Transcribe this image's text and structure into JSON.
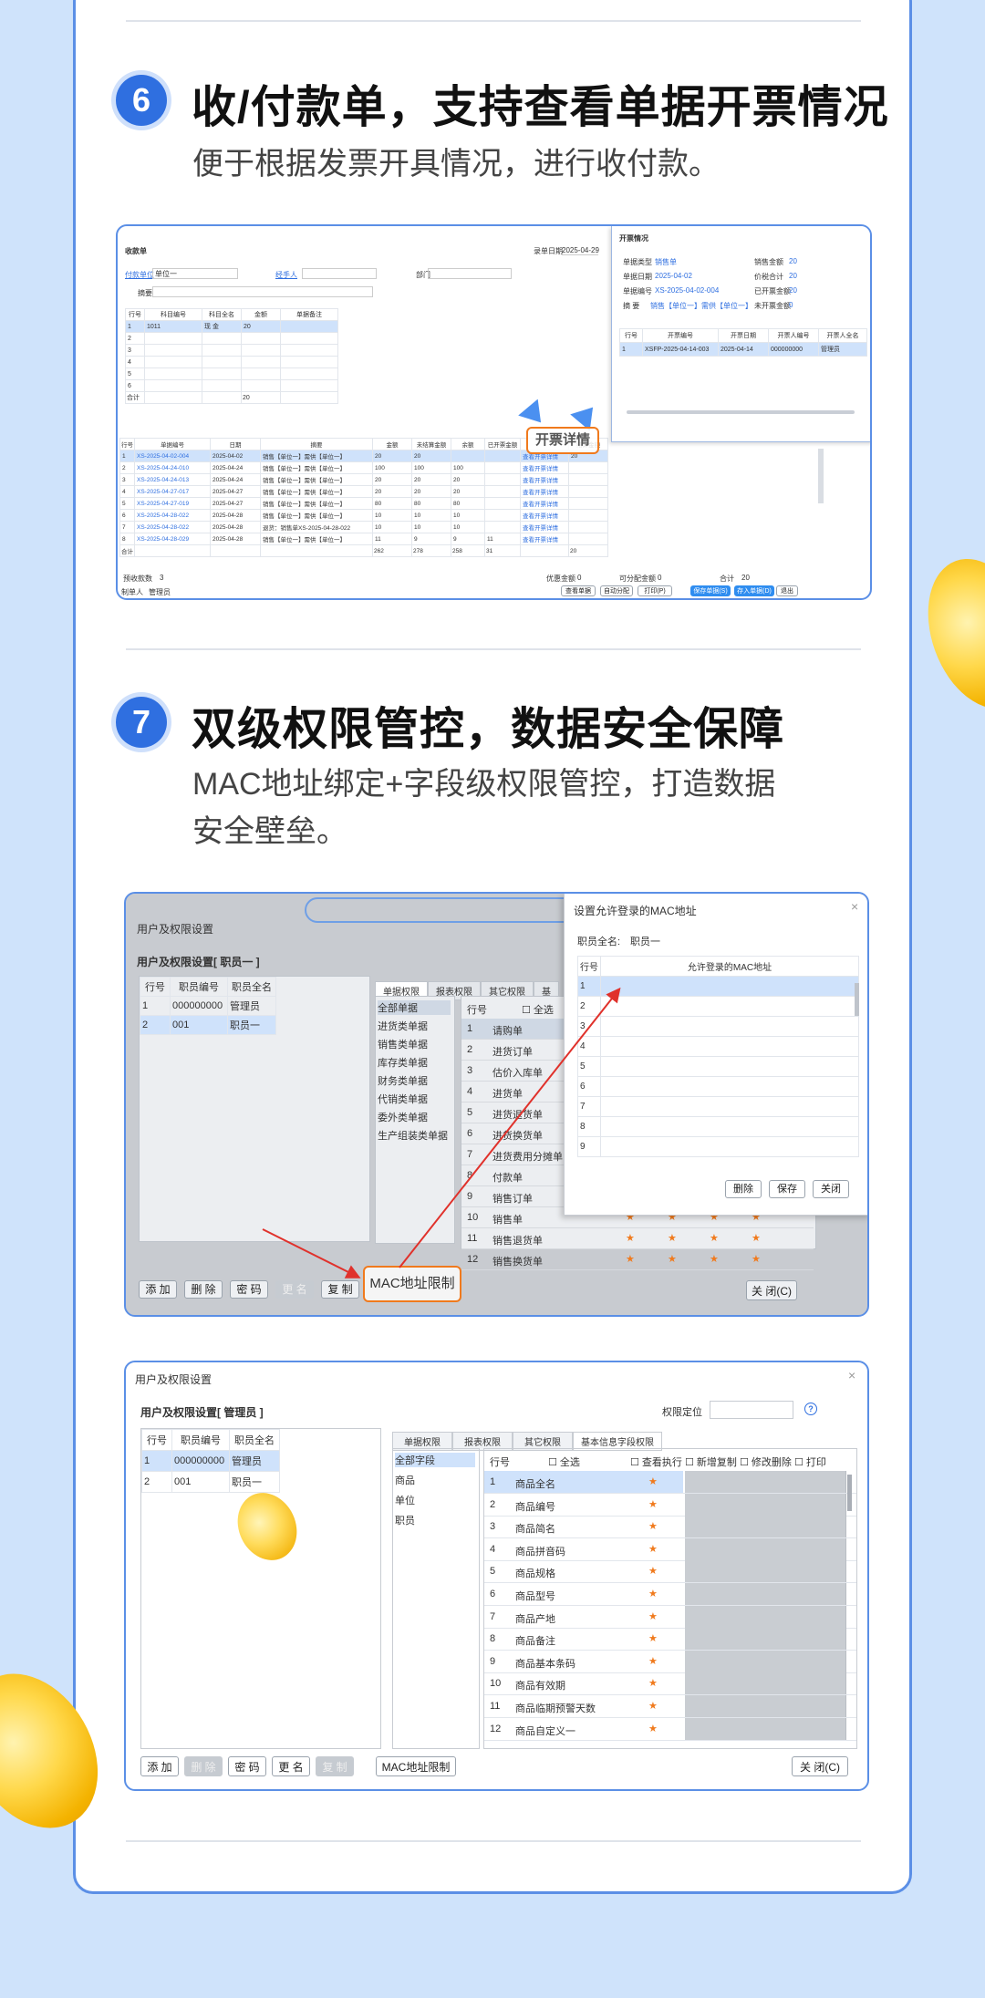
{
  "colors": {
    "accent": "#2f6fe0",
    "background": "#cfe3fb",
    "orange": "#f07a1d"
  },
  "section6": {
    "number": "6",
    "title": "收/付款单，支持查看单据开票情况",
    "subtitle": "便于根据发票开具情况，进行收付款。",
    "shot": {
      "window_title": "收款单",
      "date_label": "录单日期",
      "date_value": "2025-04-29",
      "pay_unit_label": "付款单位",
      "pay_unit_value": "单位一",
      "handler_label": "经手人",
      "dept_label": "部门",
      "summary_label": "摘要",
      "top_headers": [
        "行号",
        "科目编号",
        "科目全名",
        "金额",
        "单据备注"
      ],
      "top_rows": [
        [
          "1",
          "1011",
          "现 金",
          "20",
          ""
        ],
        [
          "2",
          "",
          "",
          "",
          ""
        ],
        [
          "3",
          "",
          "",
          "",
          ""
        ],
        [
          "4",
          "",
          "",
          "",
          ""
        ],
        [
          "5",
          "",
          "",
          "",
          ""
        ],
        [
          "6",
          "",
          "",
          "",
          ""
        ]
      ],
      "top_total_label": "合计",
      "top_total_value": "20",
      "bottom_headers": [
        "行号",
        "单据编号",
        "日期",
        "摘要",
        "金额",
        "未结算金额",
        "余额",
        "已开票金额",
        "",
        "结算金额"
      ],
      "bottom_rows": [
        [
          "1",
          "XS-2025-04-02-004",
          "2025-04-02",
          "销售【单位一】需供【单位一】",
          "20",
          "20",
          "",
          "",
          "查看开票详情",
          "20"
        ],
        [
          "2",
          "XS-2025-04-24-010",
          "2025-04-24",
          "销售【单位一】需供【单位一】",
          "100",
          "100",
          "100",
          "",
          "查看开票详情",
          ""
        ],
        [
          "3",
          "XS-2025-04-24-013",
          "2025-04-24",
          "销售【单位一】需供【单位一】",
          "20",
          "20",
          "20",
          "",
          "查看开票详情",
          ""
        ],
        [
          "4",
          "XS-2025-04-27-017",
          "2025-04-27",
          "销售【单位一】需供【单位一】",
          "20",
          "20",
          "20",
          "",
          "查看开票详情",
          ""
        ],
        [
          "5",
          "XS-2025-04-27-019",
          "2025-04-27",
          "销售【单位一】需供【单位一】",
          "80",
          "80",
          "80",
          "",
          "查看开票详情",
          ""
        ],
        [
          "6",
          "XS-2025-04-28-022",
          "2025-04-28",
          "销售【单位一】需供【单位一】",
          "10",
          "10",
          "10",
          "",
          "查看开票详情",
          ""
        ],
        [
          "7",
          "XS-2025-04-28-022",
          "2025-04-28",
          "退货：销售单XS-2025-04-28-022",
          "10",
          "10",
          "10",
          "",
          "查看开票详情",
          ""
        ],
        [
          "8",
          "XS-2025-04-28-029",
          "2025-04-28",
          "销售【单位一】需供【单位一】",
          "11",
          "9",
          "9",
          "11",
          "查看开票详情",
          ""
        ]
      ],
      "bottom_total": [
        "合计",
        "",
        "",
        "",
        "262",
        "278",
        "258",
        "31",
        "",
        "20"
      ],
      "preset_label": "预收款数",
      "preset_value": "3",
      "discount_label": "优惠金额",
      "discount_value": "0",
      "offset_label": "可分配金额",
      "offset_value": "0",
      "total_label": "合计",
      "total_value": "20",
      "maker_label": "制单人",
      "maker_value": "管理员",
      "bottom_buttons": [
        "查看单据",
        "自动分配",
        "打印(P)",
        "保存单据(S)",
        "存入单据(D)",
        "退出"
      ],
      "callout": "开票详情",
      "popup": {
        "title": "开票情况",
        "type_label": "单据类型",
        "type_value": "销售单",
        "date_label": "单据日期",
        "date_value": "2025-04-02",
        "no_label": "单据编号",
        "no_value": "XS-2025-04-02-004",
        "summary_label": "摘 要",
        "summary_value": "销售【单位一】需供【单位一】",
        "amount_label": "销售金额",
        "amount_value": "20",
        "tax_label": "价税合计",
        "tax_value": "20",
        "invoiced_label": "已开票金额",
        "invoiced_value": "20",
        "uninvoiced_label": "未开票金额",
        "uninvoiced_value": "0",
        "headers": [
          "行号",
          "开票编号",
          "开票日期",
          "开票人编号",
          "开票人全名"
        ],
        "rows": [
          [
            "1",
            "XSFP-2025-04-14-003",
            "2025-04-14",
            "000000000",
            "管理员"
          ]
        ]
      }
    }
  },
  "section7": {
    "number": "7",
    "title": "双级权限管控，数据安全保障",
    "subtitle_line1": "MAC地址绑定+字段级权限管控，打造数据",
    "subtitle_line2": "安全壁垒。",
    "shotA": {
      "window_title": "用户及权限设置",
      "heading": "用户及权限设置[ 职员一 ]",
      "user_headers": [
        "行号",
        "职员编号",
        "职员全名"
      ],
      "users": [
        [
          "1",
          "000000000",
          "管理员"
        ],
        [
          "2",
          "001",
          "职员一"
        ]
      ],
      "tabs": [
        "单据权限",
        "报表权限",
        "其它权限",
        "基"
      ],
      "categories": [
        "全部单据",
        "进货类单据",
        "销售类单据",
        "库存类单据",
        "财务类单据",
        "代销类单据",
        "委外类单据",
        "生产组装类单据"
      ],
      "perm_header_no": "行号",
      "perm_header_all": "全选",
      "perm_rows": [
        [
          "1",
          "请购单"
        ],
        [
          "2",
          "进货订单"
        ],
        [
          "3",
          "估价入库单"
        ],
        [
          "4",
          "进货单"
        ],
        [
          "5",
          "进货退货单"
        ],
        [
          "6",
          "进货换货单"
        ],
        [
          "7",
          "进货费用分摊单"
        ],
        [
          "8",
          "付款单"
        ],
        [
          "9",
          "销售订单"
        ],
        [
          "10",
          "销售单"
        ],
        [
          "11",
          "销售退货单"
        ],
        [
          "12",
          "销售换货单"
        ]
      ],
      "star": "★",
      "buttons": [
        "添 加",
        "删 除",
        "密 码",
        "更 名",
        "复 制"
      ],
      "mac_button": "MAC地址限制",
      "close_button": "关 闭(C)",
      "dialog": {
        "title": "设置允许登录的MAC地址",
        "staff_label": "职员全名:",
        "staff_value": "职员一",
        "header_no": "行号",
        "header_mac": "允许登录的MAC地址",
        "rows": [
          "1",
          "2",
          "3",
          "4",
          "5",
          "6",
          "7",
          "8",
          "9"
        ],
        "buttons": [
          "删除",
          "保存",
          "关闭"
        ]
      }
    },
    "shotB": {
      "window_title": "用户及权限设置",
      "heading": "用户及权限设置[ 管理员 ]",
      "locate_label": "权限定位",
      "user_headers": [
        "行号",
        "职员编号",
        "职员全名"
      ],
      "users": [
        [
          "1",
          "000000000",
          "管理员"
        ],
        [
          "2",
          "001",
          "职员一"
        ]
      ],
      "tabs": [
        "单据权限",
        "报表权限",
        "其它权限",
        "基本信息字段权限"
      ],
      "categories": [
        "全部字段",
        "商品",
        "单位",
        "职员"
      ],
      "field_headers": [
        "行号",
        "全选",
        "查看执行",
        "新增复制",
        "修改删除",
        "打印"
      ],
      "field_rows": [
        [
          "1",
          "商品全名"
        ],
        [
          "2",
          "商品编号"
        ],
        [
          "3",
          "商品简名"
        ],
        [
          "4",
          "商品拼音码"
        ],
        [
          "5",
          "商品规格"
        ],
        [
          "6",
          "商品型号"
        ],
        [
          "7",
          "商品产地"
        ],
        [
          "8",
          "商品备注"
        ],
        [
          "9",
          "商品基本条码"
        ],
        [
          "10",
          "商品有效期"
        ],
        [
          "11",
          "商品临期预警天数"
        ],
        [
          "12",
          "商品自定义一"
        ]
      ],
      "star": "★",
      "buttons": [
        "添 加",
        "删 除",
        "密 码",
        "更 名",
        "复 制"
      ],
      "mac_button": "MAC地址限制",
      "close_button": "关 闭(C)"
    }
  }
}
